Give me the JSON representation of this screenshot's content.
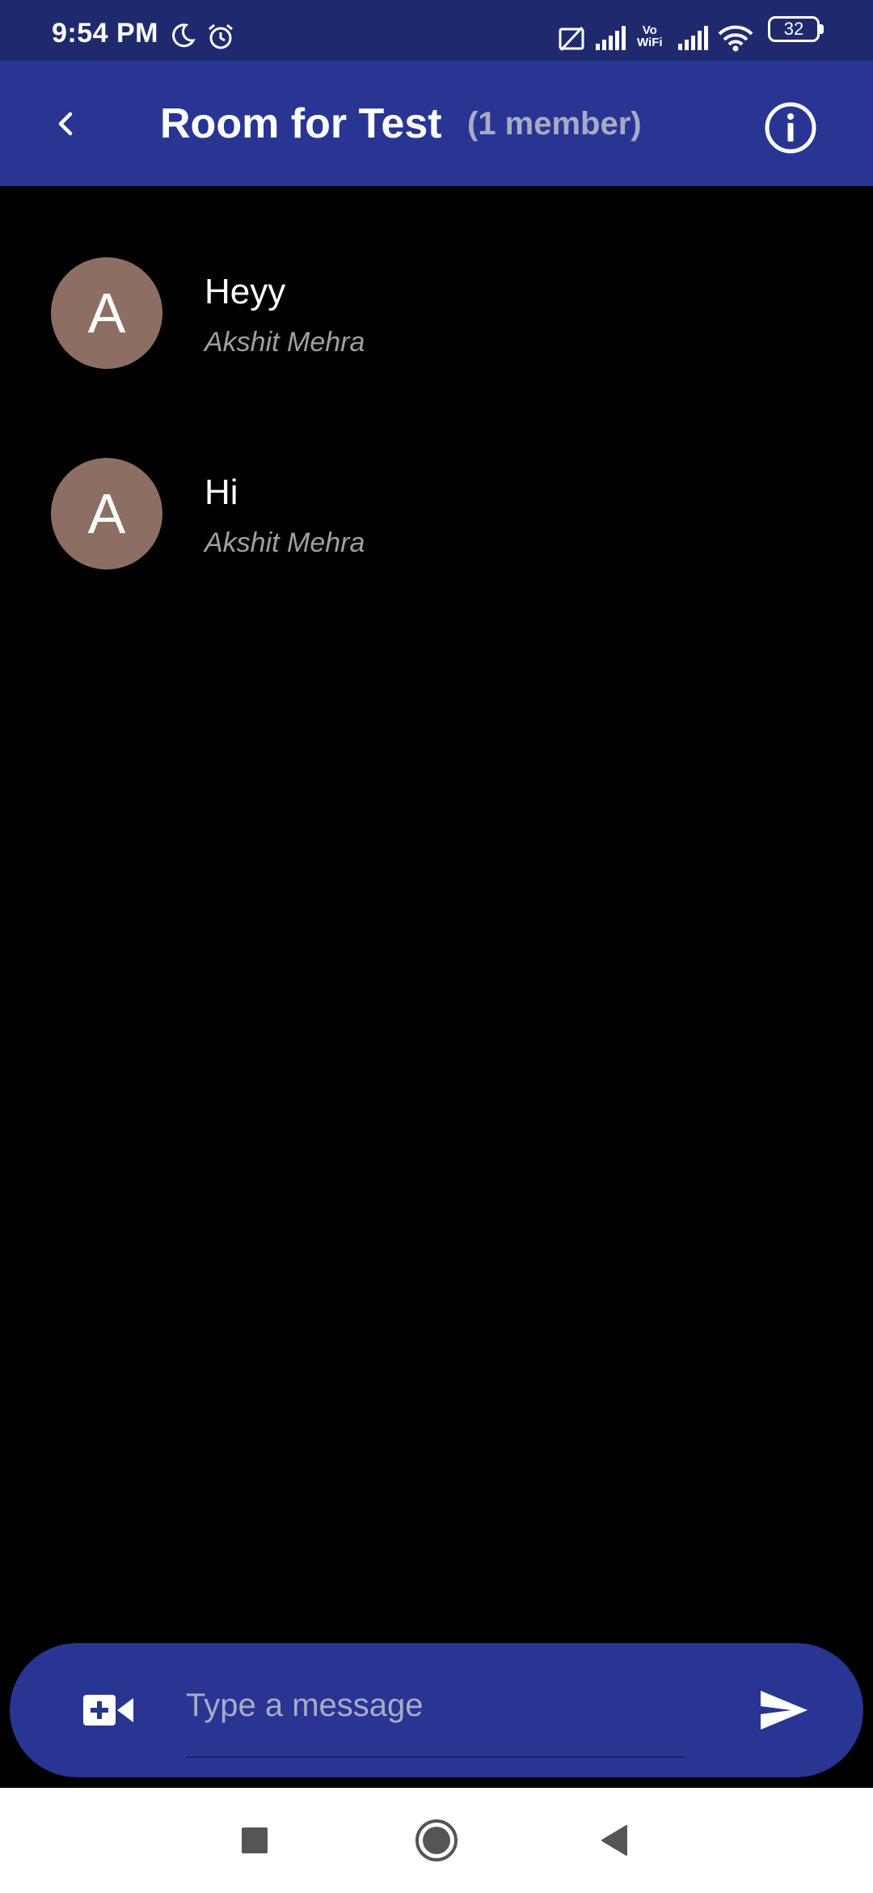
{
  "status_bar": {
    "time": "9:54 PM",
    "icons": [
      "moon-icon",
      "alarm-icon",
      "no-sim-icon",
      "signal-icon",
      "vowifi-icon",
      "signal-icon",
      "wifi-icon",
      "battery-icon"
    ],
    "vowifi_top": "Vo",
    "vowifi_bottom": "WiFi",
    "battery_level": "32"
  },
  "app_bar": {
    "back_icon": "chevron-left-icon",
    "title": "Room for Test",
    "member_count": "(1 member)",
    "info_icon": "info-icon"
  },
  "messages": [
    {
      "avatar_letter": "A",
      "text": "Heyy",
      "author": "Akshit Mehra"
    },
    {
      "avatar_letter": "A",
      "text": "Hi",
      "author": "Akshit Mehra"
    }
  ],
  "composer": {
    "placeholder": "Type a message",
    "value": "",
    "attach_icon": "video-add-icon",
    "send_icon": "send-icon"
  },
  "nav_bar": {
    "buttons": [
      "recents-square-icon",
      "home-circle-icon",
      "back-triangle-icon"
    ]
  },
  "colors": {
    "status_bar": "#1f2a6e",
    "app_bar": "#283593",
    "background": "#000000",
    "avatar": "#8d6e63",
    "member_count": "#a9abc6",
    "author": "#a0a0a0",
    "nav_bar": "#ffffff"
  }
}
